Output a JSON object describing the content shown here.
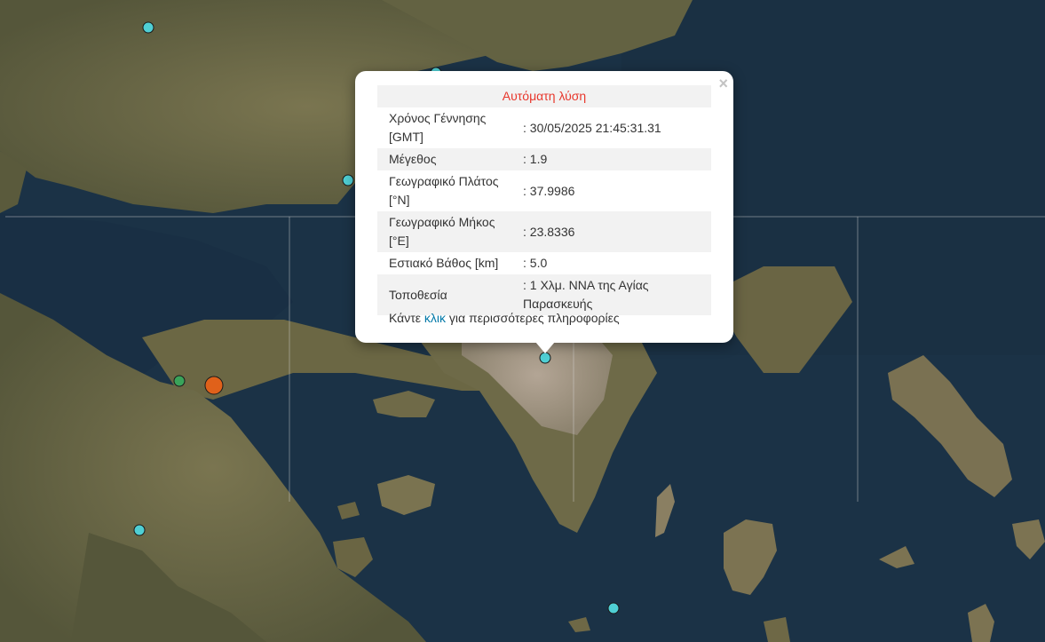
{
  "popup": {
    "title": "Αυτόματη λύση",
    "close_symbol": "×",
    "rows": [
      {
        "label": "Χρόνος Γέννησης [GMT]",
        "value": ": 30/05/2025 21:45:31.31"
      },
      {
        "label": "Μέγεθος",
        "value": ": 1.9"
      },
      {
        "label": "Γεωγραφικό Πλάτος [°N]",
        "value": ": 37.9986"
      },
      {
        "label": "Γεωγραφικό Μήκος [°E]",
        "value": ": 23.8336"
      },
      {
        "label": "Εστιακό Βάθος [km]",
        "value": ": 5.0"
      },
      {
        "label": "Τοποθεσία",
        "value": ": 1 Χλμ. ΝΝΑ της Αγίας Παρασκευής"
      }
    ],
    "more_prefix": "Κάντε ",
    "more_link": "κλικ",
    "more_suffix": " για περισσότερες πληροφορίες"
  },
  "colors": {
    "sea": "#1c3347",
    "land": "#6b6a45",
    "city": "#a8998a",
    "marker_cyan": "#4fcfd4",
    "marker_green": "#3aa35a",
    "marker_orange": "#e0611a",
    "popup_title": "#e8372c",
    "link": "#0078a8"
  },
  "markers": [
    {
      "name": "earthquake-marker-cyan",
      "color": "cyan"
    },
    {
      "name": "earthquake-marker-cyan",
      "color": "cyan"
    },
    {
      "name": "earthquake-marker-cyan",
      "color": "cyan"
    },
    {
      "name": "earthquake-marker-cyan-selected",
      "color": "cyan"
    },
    {
      "name": "earthquake-marker-cyan",
      "color": "cyan"
    },
    {
      "name": "earthquake-marker-cyan",
      "color": "cyan"
    },
    {
      "name": "earthquake-marker-green",
      "color": "green"
    },
    {
      "name": "earthquake-marker-green",
      "color": "green"
    },
    {
      "name": "earthquake-marker-orange",
      "color": "orange"
    }
  ]
}
